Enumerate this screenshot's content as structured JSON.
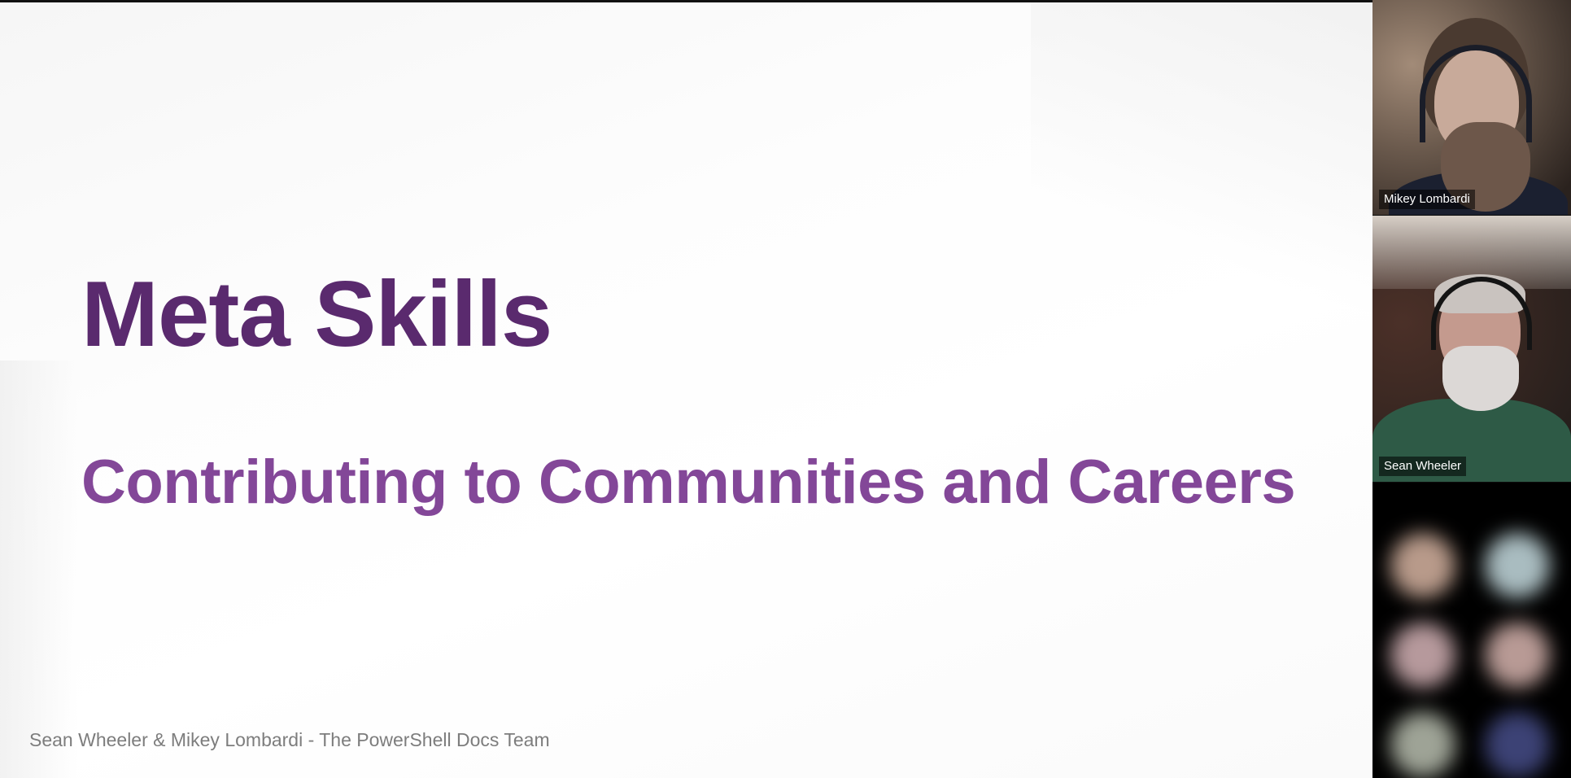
{
  "slide": {
    "title": "Meta Skills",
    "subtitle": "Contributing to Communities and Careers",
    "footer": "Sean Wheeler & Mikey Lombardi - The PowerShell Docs Team"
  },
  "participants": [
    {
      "name": "Mikey Lombardi"
    },
    {
      "name": "Sean Wheeler"
    }
  ],
  "gallery": {
    "avatar_colors": [
      "#b89a8a",
      "#a9bcc0",
      "#b6999c",
      "#b89a95",
      "#9ea396",
      "#3c4275"
    ]
  },
  "colors": {
    "title": "#5a2a6e",
    "subtitle": "#834798",
    "footer": "#7d7d7d"
  }
}
